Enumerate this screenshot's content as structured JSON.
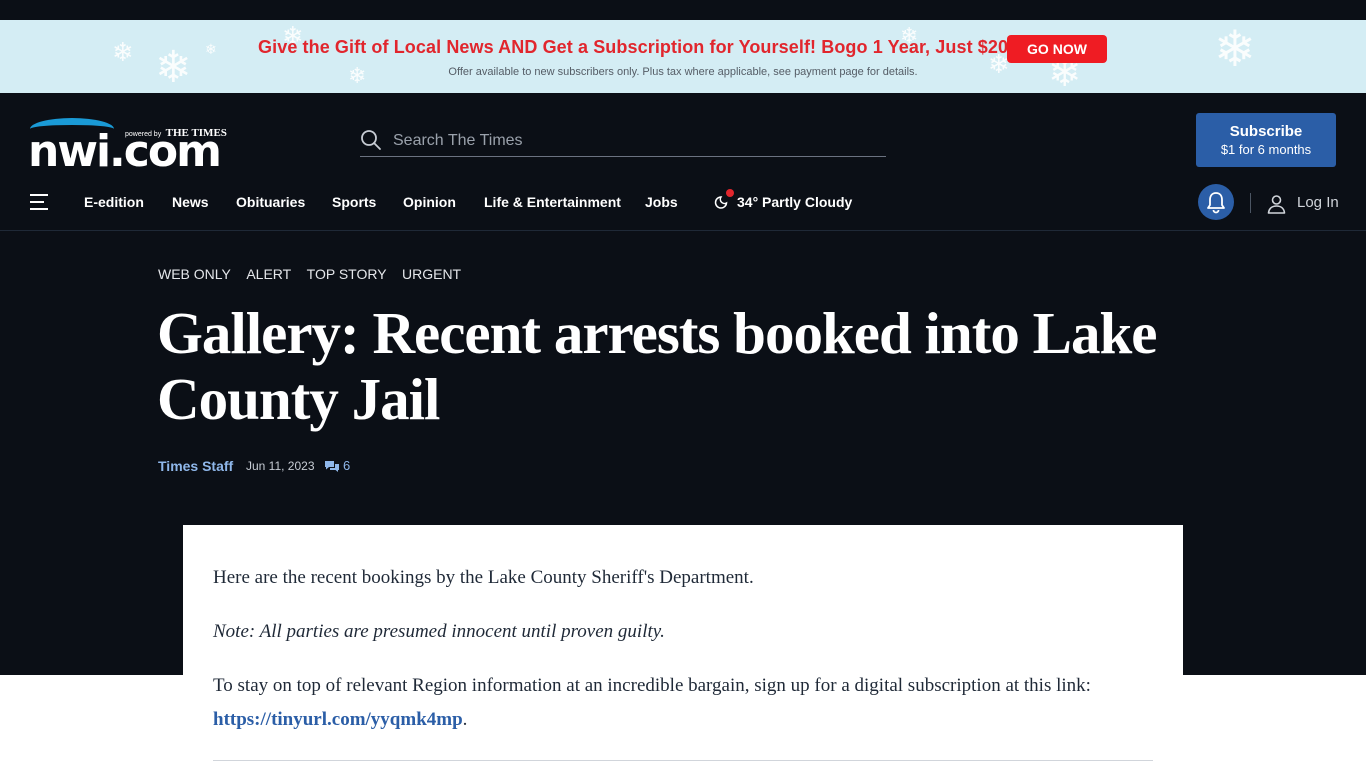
{
  "promo": {
    "headline": "Give the Gift of Local News AND Get a Subscription for Yourself! Bogo 1 Year, Just $20!",
    "fine_print": "Offer available to new subscribers only. Plus tax where applicable, see payment page for details.",
    "cta": "GO NOW"
  },
  "header": {
    "logo_text": "nwi.com",
    "powered_by": "powered by",
    "powered_brand": "THE TIMES",
    "search_placeholder": "Search The Times",
    "subscribe_line1": "Subscribe",
    "subscribe_line2": "$1 for 6 months"
  },
  "nav": {
    "items": [
      "E-edition",
      "News",
      "Obituaries",
      "Sports",
      "Opinion",
      "Life & Entertainment",
      "Jobs"
    ],
    "weather": "34° Partly Cloudy",
    "login": "Log In"
  },
  "article": {
    "tags": [
      "WEB ONLY",
      "ALERT",
      "TOP STORY",
      "URGENT"
    ],
    "title": "Gallery: Recent arrests booked into Lake County Jail",
    "author": "Times Staff",
    "date": "Jun 11, 2023",
    "comment_count": "6",
    "paragraph1": "Here are the recent bookings by the Lake County Sheriff's Department.",
    "note": "Note: All parties are presumed innocent until proven guilty.",
    "paragraph3_text": "To stay on top of relevant Region information at an incredible bargain, sign up for a digital subscription at this link: ",
    "paragraph3_link": "https://tinyurl.com/yyqmk4mp",
    "paragraph3_end": "."
  },
  "colors": {
    "dark_bg": "#0b0f16",
    "promo_bg": "#d4edf4",
    "promo_red": "#e1262d",
    "brand_blue": "#2b5ea7",
    "link_blue": "#8fb7ea"
  },
  "icons": {
    "search": "search-icon",
    "menu": "hamburger-menu-icon",
    "weather": "moon-cloud-icon",
    "bell": "bell-icon",
    "user": "user-icon",
    "comments": "comments-icon",
    "snowflake": "snowflake-icon"
  }
}
